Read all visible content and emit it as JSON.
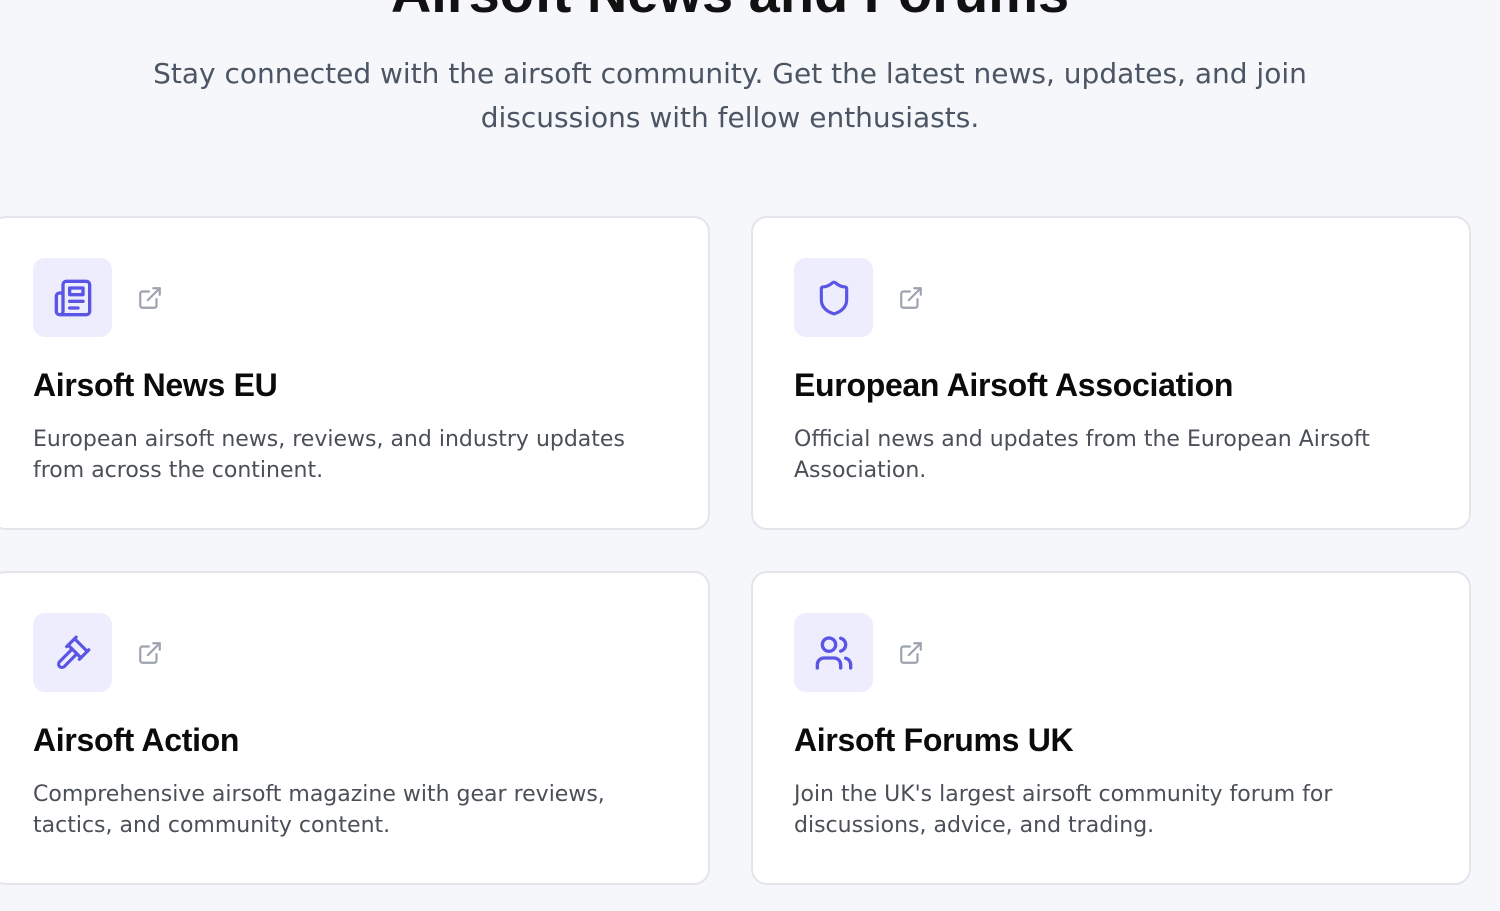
{
  "header": {
    "title": "Airsoft News and Forums",
    "subtitle": "Stay connected with the airsoft community. Get the latest news, updates, and join discussions with fellow enthusiasts."
  },
  "colors": {
    "accent": "#5b55e6",
    "icon_bg": "#eeedfd",
    "external_icon": "#9ca3af"
  },
  "cards": [
    {
      "icon": "newspaper-icon",
      "title": "Airsoft News EU",
      "description": "European airsoft news, reviews, and industry updates from across the continent."
    },
    {
      "icon": "shield-icon",
      "title": "European Airsoft Association",
      "description": "Official news and updates from the European Airsoft Association."
    },
    {
      "icon": "gavel-icon",
      "title": "Airsoft Action",
      "description": "Comprehensive airsoft magazine with gear reviews, tactics, and community content."
    },
    {
      "icon": "users-icon",
      "title": "Airsoft Forums UK",
      "description": "Join the UK's largest airsoft community forum for discussions, advice, and trading."
    }
  ]
}
